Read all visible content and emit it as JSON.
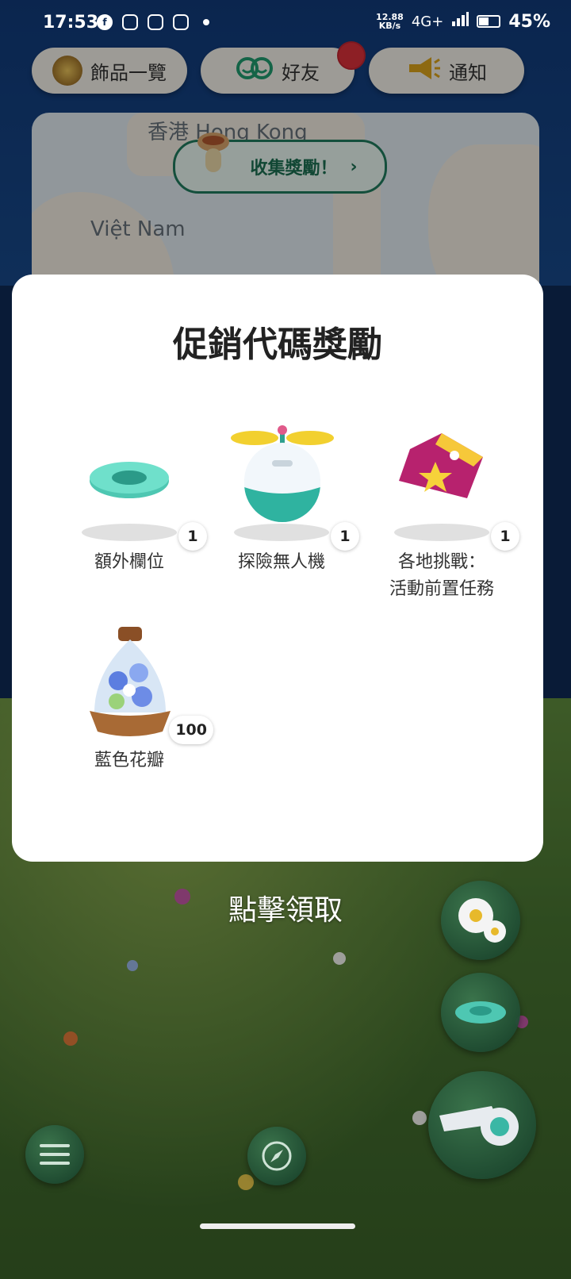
{
  "status_bar": {
    "time": "17:53",
    "speed_value": "12.88",
    "speed_unit": "KB/s",
    "network": "4G+",
    "battery": "45%"
  },
  "top_buttons": {
    "accessories": "飾品一覽",
    "friends": "好友",
    "notifications": "通知"
  },
  "map": {
    "label_hongkong": "香港 Hong Kong",
    "label_vietnam": "Việt Nam",
    "collect_button": "收集獎勵！",
    "collect_chevron": "›"
  },
  "modal": {
    "title": "促銷代碼獎勵",
    "rewards": [
      {
        "label": "額外欄位",
        "qty": "1"
      },
      {
        "label": "探險無人機",
        "qty": "1"
      },
      {
        "label_line1": "各地挑戰：",
        "label_line2": "活動前置任務",
        "qty": "1"
      },
      {
        "label": "藍色花瓣",
        "qty": "100"
      }
    ]
  },
  "tap_to_claim": "點擊領取"
}
